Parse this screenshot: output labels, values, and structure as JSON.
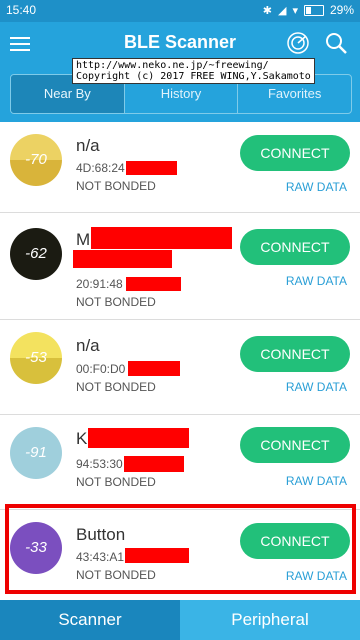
{
  "status_bar": {
    "time": "15:40",
    "battery": "29%"
  },
  "app_bar": {
    "title": "BLE Scanner"
  },
  "overlay": {
    "text": "http://www.neko.ne.jp/~freewing/\nCopyright (c) 2017 FREE WING,Y.Sakamoto"
  },
  "tabs": [
    {
      "label": "Near By"
    },
    {
      "label": "History"
    },
    {
      "label": "Favorites"
    }
  ],
  "devices": [
    {
      "rssi": "-70",
      "name": "n/a",
      "address": "4D:68:24",
      "bond": "NOT BONDED",
      "connect": "CONNECT",
      "raw": "RAW DATA",
      "color": "#e6c445"
    },
    {
      "rssi": "-62",
      "name": "M",
      "address": "20:91:48",
      "bond": "NOT BONDED",
      "connect": "CONNECT",
      "raw": "RAW DATA",
      "color": "#1b1b12"
    },
    {
      "rssi": "-53",
      "name": "n/a",
      "address": "00:F0:D0",
      "bond": "NOT BONDED",
      "connect": "CONNECT",
      "raw": "RAW DATA",
      "color": "#ead24a"
    },
    {
      "rssi": "-91",
      "name": "K",
      "address": "94:53:30",
      "bond": "NOT BONDED",
      "connect": "CONNECT",
      "raw": "RAW DATA",
      "color": "#9fcfdc"
    },
    {
      "rssi": "-33",
      "name": "Button",
      "address": "43:43:A1",
      "bond": "NOT BONDED",
      "connect": "CONNECT",
      "raw": "RAW DATA",
      "color": "#7b4fbf"
    }
  ],
  "bottom_nav": [
    {
      "label": "Scanner"
    },
    {
      "label": "Peripheral"
    }
  ]
}
